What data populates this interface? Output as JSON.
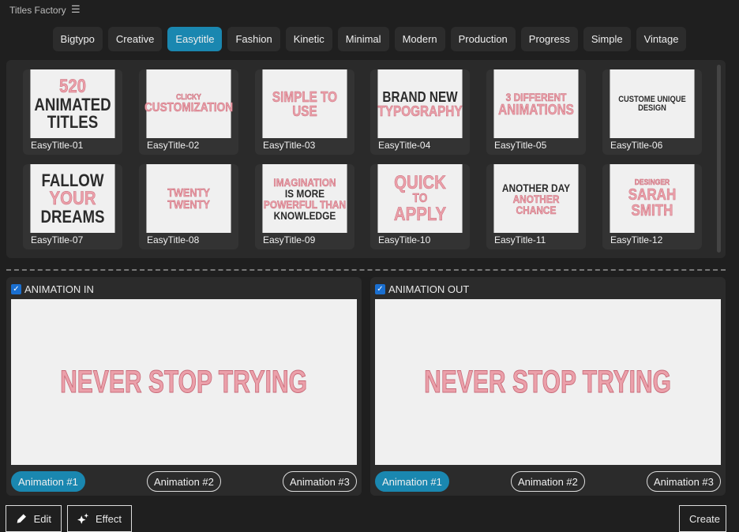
{
  "app": {
    "title": "Titles Factory"
  },
  "tabs": [
    "Bigtypo",
    "Creative",
    "Easytitle",
    "Fashion",
    "Kinetic",
    "Minimal",
    "Modern",
    "Production",
    "Progress",
    "Simple",
    "Vintage"
  ],
  "active_tab": "Easytitle",
  "templates": [
    {
      "label": "EasyTitle-01",
      "lines": [
        [
          "520",
          "pk",
          24
        ],
        [
          "ANIMATED",
          "dk",
          22
        ],
        [
          "TITLES",
          "dk",
          22
        ]
      ]
    },
    {
      "label": "EasyTitle-02",
      "lines": [
        [
          "CLICKY",
          "pk",
          10
        ],
        [
          "CUSTOMIZATION",
          "pk",
          16
        ]
      ]
    },
    {
      "label": "EasyTitle-03",
      "lines": [
        [
          "SIMPLE TO USE",
          "pk",
          18
        ]
      ]
    },
    {
      "label": "EasyTitle-04",
      "lines": [
        [
          "BRAND NEW",
          "dk",
          18
        ],
        [
          "TYPOGRAPHY",
          "pk",
          18
        ]
      ]
    },
    {
      "label": "EasyTitle-05",
      "lines": [
        [
          "3 DIFFERENT",
          "pk",
          14
        ],
        [
          "ANIMATIONS",
          "pk",
          18
        ]
      ]
    },
    {
      "label": "EasyTitle-06",
      "lines": [
        [
          "CUSTOME UNIQUE DESIGN",
          "dk",
          11
        ]
      ]
    },
    {
      "label": "EasyTitle-07",
      "lines": [
        [
          "FALLOW",
          "dk",
          22
        ],
        [
          "YOUR",
          "pk",
          24
        ],
        [
          "DREAMS",
          "dk",
          22
        ]
      ]
    },
    {
      "label": "EasyTitle-08",
      "lines": [
        [
          "TWENTY TWENTY",
          "pk",
          15
        ]
      ]
    },
    {
      "label": "EasyTitle-09",
      "lines": [
        [
          "IMAGINATION",
          "pk",
          14
        ],
        [
          "IS MORE",
          "dk",
          14
        ],
        [
          "POWERFUL THAN",
          "pk",
          14
        ],
        [
          "KNOWLEDGE",
          "dk",
          14
        ]
      ]
    },
    {
      "label": "EasyTitle-10",
      "lines": [
        [
          "QUICK",
          "pk",
          24
        ],
        [
          "TO",
          "pk",
          16
        ],
        [
          "APPLY",
          "pk",
          24
        ]
      ]
    },
    {
      "label": "EasyTitle-11",
      "lines": [
        [
          "ANOTHER DAY",
          "dk",
          14
        ],
        [
          "ANOTHER CHANCE",
          "pk",
          14
        ]
      ]
    },
    {
      "label": "EasyTitle-12",
      "lines": [
        [
          "DESINGER",
          "pk",
          10
        ],
        [
          "SARAH SMITH",
          "pk",
          20
        ]
      ]
    }
  ],
  "panels": [
    {
      "heading": "ANIMATION IN",
      "preview_text": "NEVER STOP TRYING",
      "buttons": [
        "Animation #1",
        "Animation #2",
        "Animation #3"
      ],
      "active": 0
    },
    {
      "heading": "ANIMATION OUT",
      "preview_text": "NEVER STOP TRYING",
      "buttons": [
        "Animation #1",
        "Animation #2",
        "Animation #3"
      ],
      "active": 0
    }
  ],
  "bottom": {
    "edit": "Edit",
    "effect": "Effect",
    "create": "Create"
  }
}
